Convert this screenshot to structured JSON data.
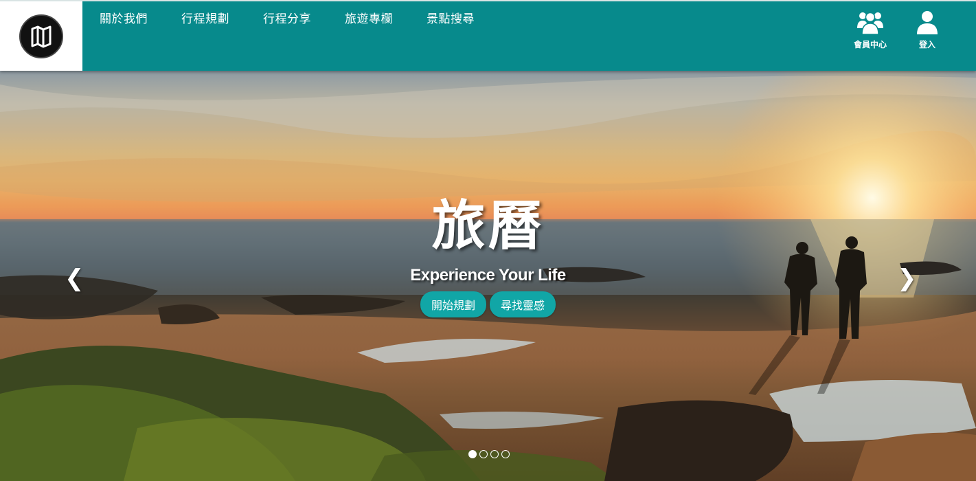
{
  "header": {
    "logo_icon": "folded-map-icon",
    "nav": [
      {
        "label": "關於我們"
      },
      {
        "label": "行程規劃"
      },
      {
        "label": "行程分享"
      },
      {
        "label": "旅遊專欄"
      },
      {
        "label": "景點搜尋"
      }
    ],
    "member_center": {
      "label": "會員中心",
      "icon": "users-group-icon"
    },
    "login": {
      "label": "登入",
      "icon": "user-icon"
    },
    "colors": {
      "bar": "#078a8c",
      "logo_bg": "#ffffff"
    }
  },
  "hero": {
    "title": "旅曆",
    "subtitle": "Experience Your Life",
    "buttons": [
      {
        "label": "開始規劃"
      },
      {
        "label": "尋找靈感"
      }
    ],
    "prev_icon": "chevron-left-icon",
    "next_icon": "chevron-right-icon",
    "prev_glyph": "❮",
    "next_glyph": "❯",
    "slides_count": 4,
    "active_slide": 1,
    "button_color": "#11a6a6"
  }
}
